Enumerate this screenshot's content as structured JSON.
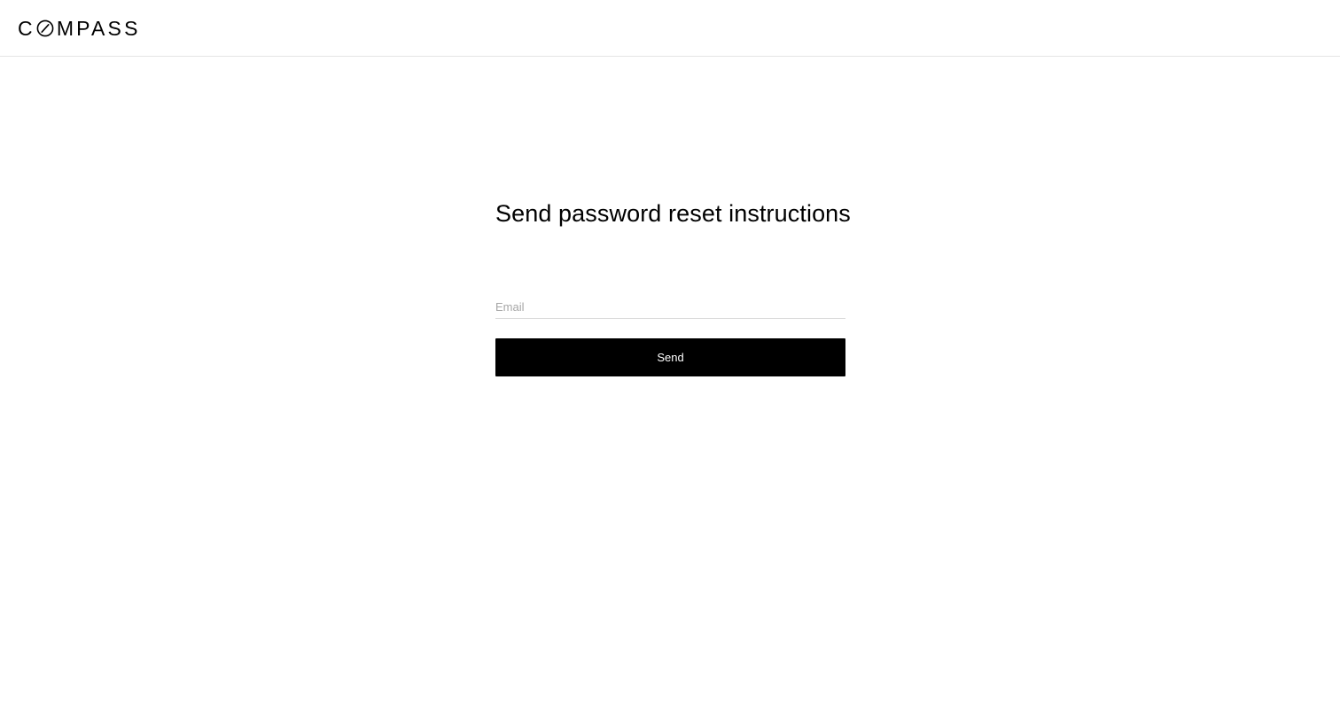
{
  "header": {
    "logo_text_before": "C",
    "logo_text_after": "MPASS"
  },
  "main": {
    "title": "Send password reset instructions",
    "email": {
      "value": "",
      "placeholder": "Email"
    },
    "send_label": "Send"
  },
  "colors": {
    "button_background": "#000000",
    "button_text": "#ffffff",
    "placeholder": "#a6a6a6",
    "divider": "#e5e5e5"
  },
  "icons": {
    "logo_o": "compass-o-slash-icon"
  }
}
